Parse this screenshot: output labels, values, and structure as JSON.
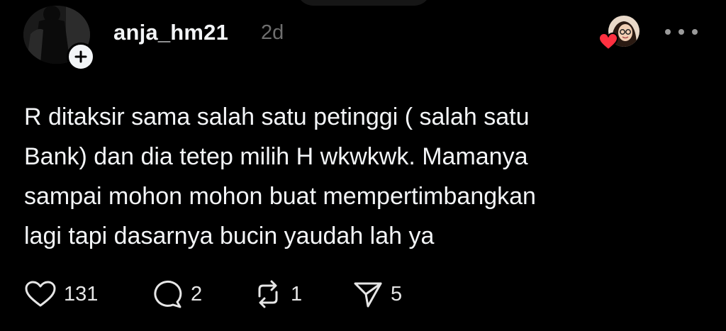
{
  "post": {
    "username": "anja_hm21",
    "timestamp": "2d",
    "body_lines": [
      "R ditaksir sama salah satu petinggi ( salah satu",
      "Bank) dan dia tetep milih H wkwkwk. Mamanya",
      "sampai mohon mohon buat mempertimbangkan",
      "lagi tapi dasarnya bucin yaudah lah ya"
    ]
  },
  "actions": {
    "like_count": "131",
    "reply_count": "2",
    "repost_count": "1",
    "share_count": "5"
  },
  "icons": {
    "follow": "plus-icon",
    "more": "more-horizontal-icon",
    "like": "heart-icon",
    "reply": "comment-bubble-icon",
    "repost": "repost-icon",
    "share": "send-icon",
    "reply_liked": "red-heart-icon"
  },
  "colors": {
    "background": "#000000",
    "text_primary": "#f3f5f7",
    "text_secondary": "#6e6e6e",
    "heart_red": "#ff3040"
  }
}
